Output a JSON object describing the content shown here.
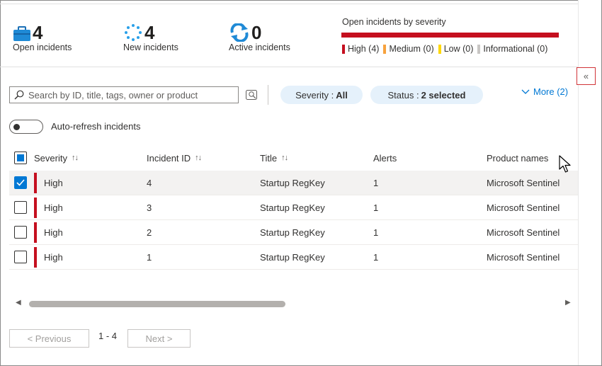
{
  "stats": {
    "open": {
      "count": "4",
      "label": "Open incidents",
      "icon": "briefcase-icon"
    },
    "new": {
      "count": "4",
      "label": "New incidents",
      "icon": "spinner-icon"
    },
    "active": {
      "count": "0",
      "label": "Active incidents",
      "icon": "refresh-icon"
    }
  },
  "severity_chart": {
    "title": "Open incidents by severity",
    "high_fraction": 1.0,
    "legend": [
      {
        "label": "High (4)",
        "color": "#c50f1f"
      },
      {
        "label": "Medium (0)",
        "color": "#f7a23d"
      },
      {
        "label": "Low (0)",
        "color": "#ffd800"
      },
      {
        "label": "Informational (0)",
        "color": "#c8c6c4"
      }
    ]
  },
  "toolbar": {
    "search_placeholder": "Search by ID, title, tags, owner or product",
    "severity_filter": {
      "label": "Severity :",
      "value": "All"
    },
    "status_filter": {
      "label": "Status :",
      "value": "2 selected"
    },
    "more_label": "More (2)"
  },
  "auto_refresh": {
    "label": "Auto-refresh incidents",
    "on": false
  },
  "collapse_label": "«",
  "table": {
    "columns": {
      "severity": "Severity",
      "incident_id": "Incident ID",
      "title": "Title",
      "alerts": "Alerts",
      "product_names": "Product names"
    },
    "sort_glyph": "↑↓",
    "rows": [
      {
        "severity": "High",
        "id": "4",
        "title": "Startup RegKey",
        "alerts": "1",
        "product": "Microsoft Sentinel",
        "selected": true
      },
      {
        "severity": "High",
        "id": "3",
        "title": "Startup RegKey",
        "alerts": "1",
        "product": "Microsoft Sentinel",
        "selected": false
      },
      {
        "severity": "High",
        "id": "2",
        "title": "Startup RegKey",
        "alerts": "1",
        "product": "Microsoft Sentinel",
        "selected": false
      },
      {
        "severity": "High",
        "id": "1",
        "title": "Startup RegKey",
        "alerts": "1",
        "product": "Microsoft Sentinel",
        "selected": false
      }
    ]
  },
  "pagination": {
    "previous": "< Previous",
    "range": "1 - 4",
    "next": "Next >"
  }
}
